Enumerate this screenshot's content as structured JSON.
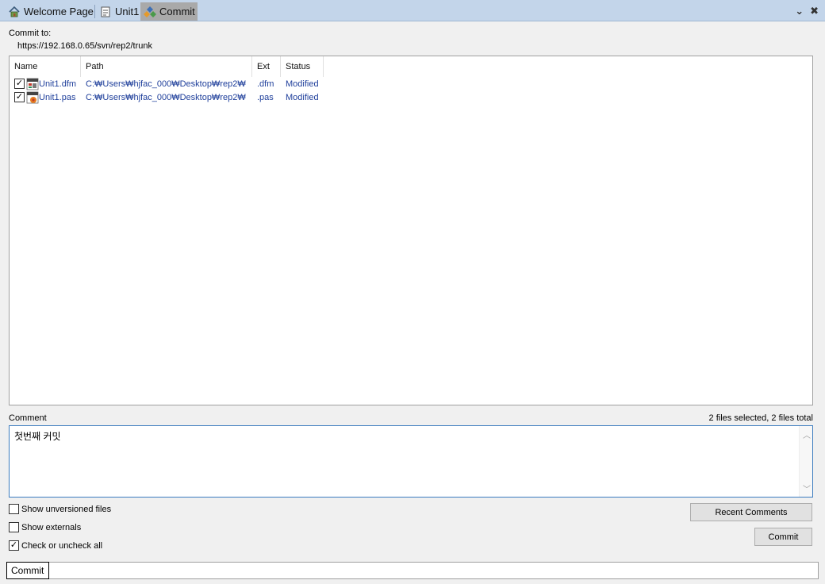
{
  "tabs": [
    {
      "label": "Welcome Page",
      "icon": "home-icon"
    },
    {
      "label": "Unit1",
      "icon": "unit-file-icon"
    },
    {
      "label": "Commit",
      "icon": "commit-icon"
    }
  ],
  "tab_actions": {
    "menu_glyph": "⌄",
    "close_glyph": "✖"
  },
  "commit_to": {
    "label": "Commit to:",
    "url": "https://192.168.0.65/svn/rep2/trunk"
  },
  "file_list": {
    "columns": [
      "Name",
      "Path",
      "Ext",
      "Status"
    ],
    "rows": [
      {
        "name": "Unit1.dfm",
        "path": "C:₩Users₩hjfac_000₩Desktop₩rep2₩",
        "ext": ".dfm",
        "status": "Modified",
        "checked": true
      },
      {
        "name": "Unit1.pas",
        "path": "C:₩Users₩hjfac_000₩Desktop₩rep2₩",
        "ext": ".pas",
        "status": "Modified",
        "checked": true
      }
    ]
  },
  "comment": {
    "label": "Comment",
    "value": "첫번째 커밋",
    "summary": "2 files selected, 2 files total"
  },
  "options": {
    "show_unversioned": "Show unversioned files",
    "show_externals": "Show externals",
    "check_all": "Check or uncheck all"
  },
  "buttons": {
    "recent_comments": "Recent Comments",
    "commit": "Commit"
  },
  "bottom_tab": "Commit",
  "colors": {
    "tabbar": "#c3d5ea",
    "active_tab": "#a9a9a9",
    "link_text": "#1f3f9b",
    "focus_border": "#3b7bbf"
  }
}
